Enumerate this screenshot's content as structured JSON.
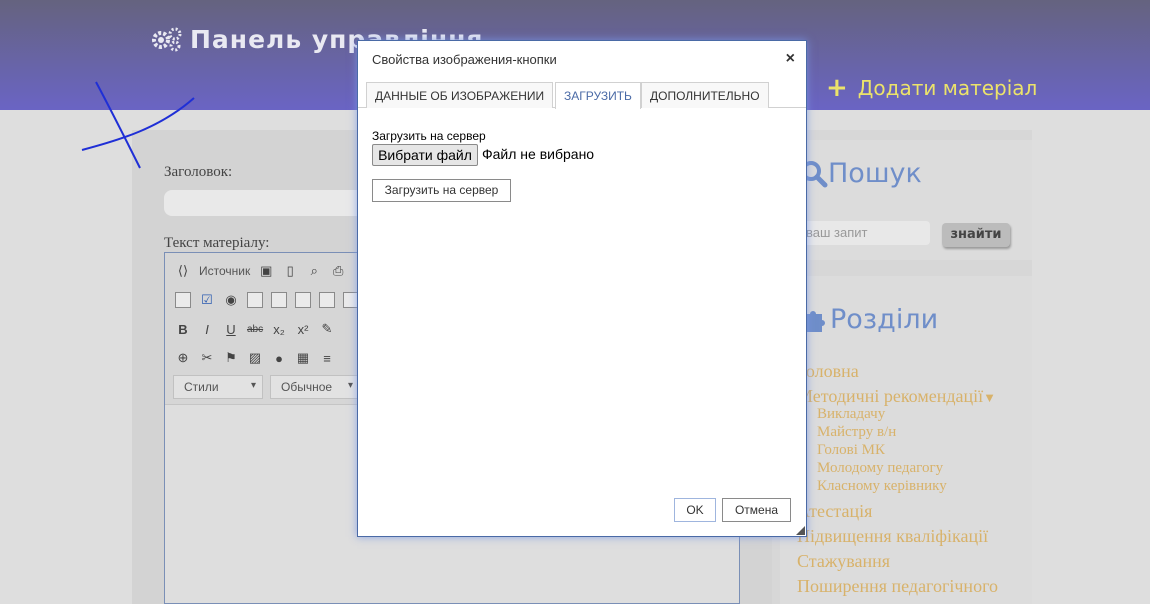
{
  "header": {
    "title": "Панель управління",
    "add_material": "Додати матеріал"
  },
  "content": {
    "title_label": "Заголовок:",
    "text_label": "Текст матеріалу:",
    "toolbar": {
      "source_label": "Источник",
      "styles_combo": "Стили",
      "format_combo": "Обычное"
    }
  },
  "sidebar": {
    "search_title": "Пошук",
    "search_placeholder": "ваш запит",
    "search_button": "знайти",
    "sections_title": "Розділи",
    "items": [
      {
        "label": "Головна"
      },
      {
        "label": "Методичні рекомендації"
      },
      {
        "label": "Викладачу"
      },
      {
        "label": "Майстру в/н"
      },
      {
        "label": "Голові МК"
      },
      {
        "label": "Молодому педагогу"
      },
      {
        "label": "Класному керівнику"
      },
      {
        "label": "Атестація"
      },
      {
        "label": "Підвищення кваліфікації"
      },
      {
        "label": "Стажування"
      },
      {
        "label": "Поширення педагогічного"
      }
    ]
  },
  "dialog": {
    "title": "Свойства изображения-кнопки",
    "close": "×",
    "tabs": [
      {
        "label": "ДАННЫЕ ОБ ИЗОБРАЖЕНИИ"
      },
      {
        "label": "ЗАГРУЗИТЬ"
      },
      {
        "label": "ДОПОЛНИТЕЛЬНО"
      }
    ],
    "upload_label": "Загрузить на сервер",
    "choose_file": "Вибрати файл",
    "file_status": "Файл не вибрано",
    "upload_button": "Загрузить на сервер",
    "ok": "OK",
    "cancel": "Отмена"
  },
  "colors": {
    "header_top": "#65637f",
    "header_bottom": "#6a64c4",
    "accent_yellow": "#ece36a",
    "link_gold": "#d8b26a",
    "sidebar_blue": "#6f8ec9"
  }
}
